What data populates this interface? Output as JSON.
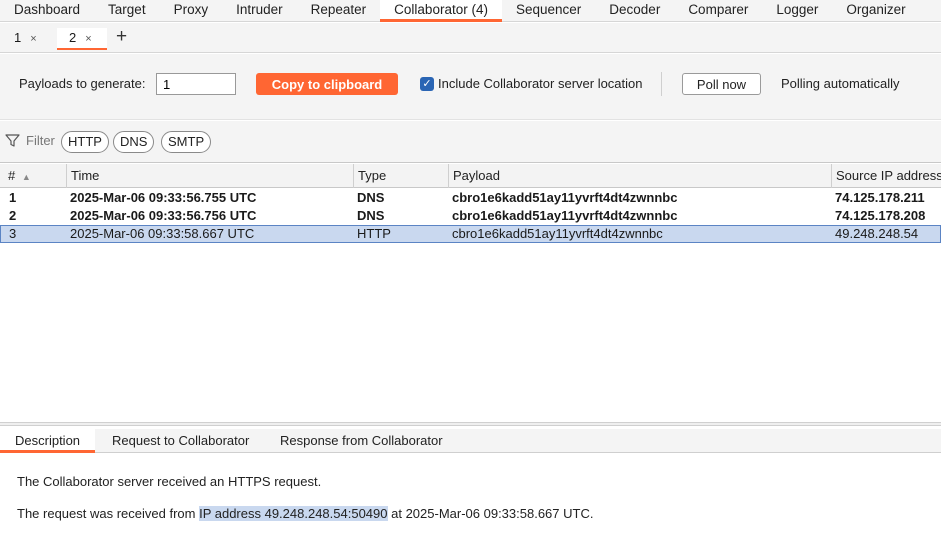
{
  "top_tabs": [
    "Dashboard",
    "Target",
    "Proxy",
    "Intruder",
    "Repeater",
    "Collaborator (4)",
    "Sequencer",
    "Decoder",
    "Comparer",
    "Logger",
    "Organizer"
  ],
  "active_top_tab": "Collaborator (4)",
  "sub_tabs": [
    {
      "label": "1",
      "close": "×"
    },
    {
      "label": "2",
      "close": "×"
    }
  ],
  "add_tab_glyph": "+",
  "controls": {
    "payloads_label": "Payloads to generate:",
    "payloads_value": "1",
    "copy_button": "Copy to clipboard",
    "include_location_checked": true,
    "include_location_label": "Include Collaborator server location",
    "poll_button": "Poll now",
    "polling_status": "Polling automatically"
  },
  "filter": {
    "label": "Filter",
    "chips": [
      "HTTP",
      "DNS",
      "SMTP"
    ]
  },
  "table": {
    "columns": [
      "#",
      "Time",
      "Type",
      "Payload",
      "Source IP address"
    ],
    "rows": [
      {
        "num": "1",
        "time": "2025-Mar-06 09:33:56.755 UTC",
        "type": "DNS",
        "payload": "cbro1e6kadd51ay11yvrft4dt4zwnnbc",
        "source_ip": "74.125.178.211"
      },
      {
        "num": "2",
        "time": "2025-Mar-06 09:33:56.756 UTC",
        "type": "DNS",
        "payload": "cbro1e6kadd51ay11yvrft4dt4zwnnbc",
        "source_ip": "74.125.178.208"
      },
      {
        "num": "3",
        "time": "2025-Mar-06 09:33:58.667 UTC",
        "type": "HTTP",
        "payload": "cbro1e6kadd51ay11yvrft4dt4zwnnbc",
        "source_ip": "49.248.248.54"
      }
    ]
  },
  "bottom_tabs": [
    "Description",
    "Request to Collaborator",
    "Response from Collaborator"
  ],
  "description": {
    "line1": "The Collaborator server received an HTTPS request.",
    "line2_prefix": "The request was received from ",
    "line2_highlight": "IP address 49.248.248.54:50490",
    "line2_suffix": " at 2025-Mar-06 09:33:58.667 UTC."
  },
  "colors": {
    "accent": "#ff6633",
    "selection": "#c9d8ef",
    "checkbox": "#2a65b4"
  }
}
